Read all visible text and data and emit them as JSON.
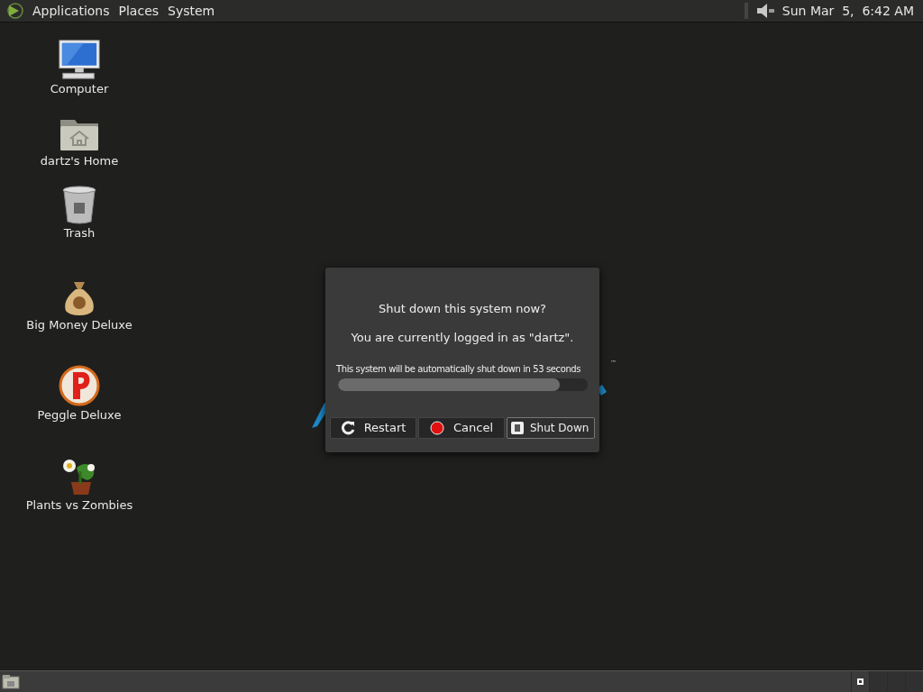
{
  "top_panel": {
    "menus": [
      {
        "label": "Applications"
      },
      {
        "label": "Places"
      },
      {
        "label": "System"
      }
    ],
    "clock": "Sun Mar  5,  6:42 AM"
  },
  "desktop": {
    "places": [
      {
        "kind": "computer",
        "label": "Computer"
      },
      {
        "kind": "home",
        "label": "dartz's Home"
      },
      {
        "kind": "trash",
        "label": "Trash"
      }
    ],
    "apps": [
      {
        "kind": "money",
        "label": "Big Money Deluxe"
      },
      {
        "kind": "peggle",
        "label": "Peggle Deluxe"
      },
      {
        "kind": "plants",
        "label": "Plants vs Zombies"
      }
    ],
    "wallpaper_mark": "™"
  },
  "dialog": {
    "title": "Shut down this system now?",
    "message": "You are currently logged in as \"dartz\".",
    "countdown": "This system will be automatically shut down in 53 seconds",
    "progress": {
      "level": 0.89
    },
    "buttons": [
      {
        "kind": "restart",
        "label": "Restart",
        "selected": false
      },
      {
        "kind": "cancel",
        "label": "Cancel",
        "selected": false
      },
      {
        "kind": "shutdown",
        "label": "Shut Down",
        "selected": true
      }
    ]
  },
  "bottom_panel": {
    "workspaces": [
      {
        "selected": true
      },
      {
        "selected": false
      },
      {
        "selected": false
      },
      {
        "selected": false
      }
    ]
  }
}
